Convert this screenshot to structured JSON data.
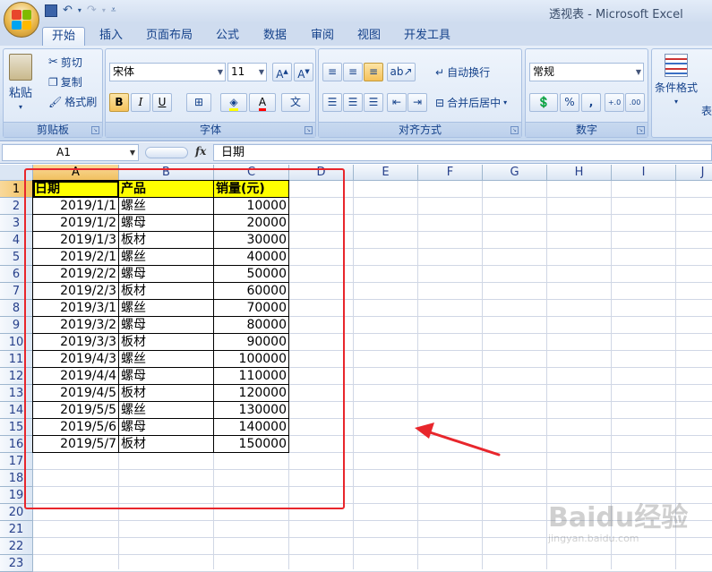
{
  "window": {
    "title": "透视表 - Microsoft Excel"
  },
  "ribbon": {
    "tabs": [
      "开始",
      "插入",
      "页面布局",
      "公式",
      "数据",
      "审阅",
      "视图",
      "开发工具"
    ],
    "active_tab": "开始",
    "clipboard": {
      "paste": "粘贴",
      "cut": "剪切",
      "copy": "复制",
      "format_painter": "格式刷",
      "label": "剪贴板"
    },
    "font": {
      "name": "宋体",
      "size": "11",
      "bold": "B",
      "italic": "I",
      "underline": "U",
      "label": "字体"
    },
    "alignment": {
      "wrap_text": "自动换行",
      "merge_center": "合并后居中",
      "label": "对齐方式"
    },
    "number": {
      "format": "常规",
      "percent": "%",
      "comma": ",",
      "label": "数字"
    },
    "styles": {
      "conditional_format": "条件格式",
      "table_partial": "表"
    }
  },
  "formula_bar": {
    "name_box": "A1",
    "fx": "fx",
    "formula": "日期"
  },
  "grid": {
    "columns": [
      "A",
      "B",
      "C",
      "D",
      "E",
      "F",
      "G",
      "H",
      "I",
      "J"
    ],
    "selected_column": "A",
    "rows": [
      "1",
      "2",
      "3",
      "4",
      "5",
      "6",
      "7",
      "8",
      "9",
      "10",
      "11",
      "12",
      "13",
      "14",
      "15",
      "16",
      "17",
      "18",
      "19",
      "20",
      "21",
      "22",
      "23"
    ],
    "selected_row": "1",
    "headers": [
      "日期",
      "产品",
      "销量(元)"
    ],
    "data": [
      [
        "2019/1/1",
        "螺丝",
        "10000"
      ],
      [
        "2019/1/2",
        "螺母",
        "20000"
      ],
      [
        "2019/1/3",
        "板材",
        "30000"
      ],
      [
        "2019/2/1",
        "螺丝",
        "40000"
      ],
      [
        "2019/2/2",
        "螺母",
        "50000"
      ],
      [
        "2019/2/3",
        "板材",
        "60000"
      ],
      [
        "2019/3/1",
        "螺丝",
        "70000"
      ],
      [
        "2019/3/2",
        "螺母",
        "80000"
      ],
      [
        "2019/3/3",
        "板材",
        "90000"
      ],
      [
        "2019/4/3",
        "螺丝",
        "100000"
      ],
      [
        "2019/4/4",
        "螺母",
        "110000"
      ],
      [
        "2019/4/5",
        "板材",
        "120000"
      ],
      [
        "2019/5/5",
        "螺丝",
        "130000"
      ],
      [
        "2019/5/6",
        "螺母",
        "140000"
      ],
      [
        "2019/5/7",
        "板材",
        "150000"
      ]
    ]
  },
  "annotation": {
    "highlight_color": "#e8262c"
  },
  "watermark": {
    "brand": "Baidu经验",
    "url": "jingyan.baidu.com"
  }
}
